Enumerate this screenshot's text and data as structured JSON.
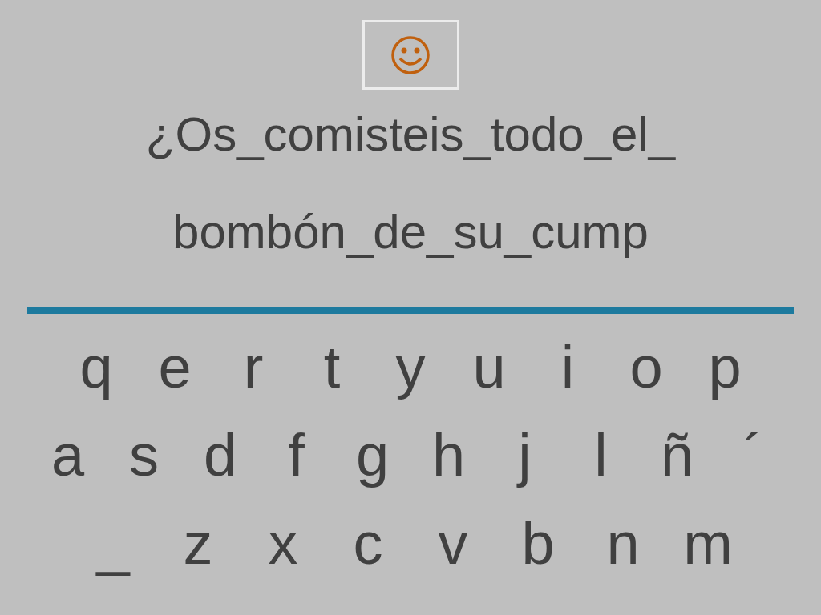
{
  "sentence_lines": [
    "¿Os_comisteis_todo_el_",
    "bombón_de_su_cump"
  ],
  "keyboard_rows": [
    [
      "q",
      "e",
      "r",
      "t",
      "y",
      "u",
      "i",
      "o",
      "p"
    ],
    [
      "a",
      "s",
      "d",
      "f",
      "g",
      "h",
      "j",
      "l",
      "ñ",
      "´"
    ],
    [
      "_",
      "z",
      "x",
      "c",
      "v",
      "b",
      "n",
      "m"
    ]
  ]
}
